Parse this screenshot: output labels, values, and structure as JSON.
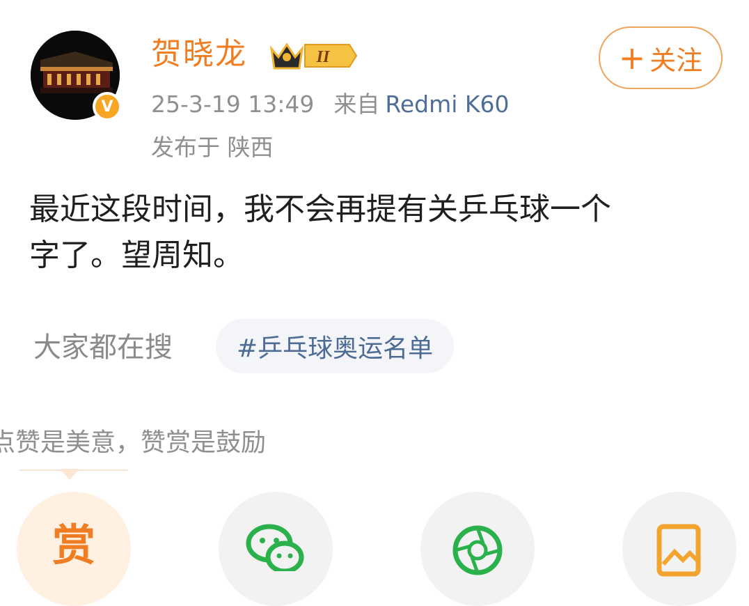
{
  "post": {
    "author": "贺晓龙",
    "level_badge": "II",
    "timestamp": "25-3-19 13:49",
    "from_label": "来自",
    "device": "Redmi K60",
    "location": "发布于 陕西",
    "content_line1": "最近这段时间，我不会再提有关乒乓球一个",
    "content_line2": "字了。望周知。",
    "verified_mark": "V"
  },
  "follow": {
    "plus": "+",
    "label": "关注"
  },
  "search": {
    "label": "大家都在搜",
    "tag": "#乒乓球奥运名单"
  },
  "reward": {
    "text": "点赞是美意，赞赏是鼓励",
    "reward_button": "赏"
  },
  "share": {
    "icons": [
      "reward-icon",
      "wechat-icon",
      "moments-icon",
      "image-save-icon"
    ]
  },
  "colors": {
    "accent": "#f07d21",
    "device_link": "#4f6e97",
    "muted": "#8f8f8f"
  }
}
